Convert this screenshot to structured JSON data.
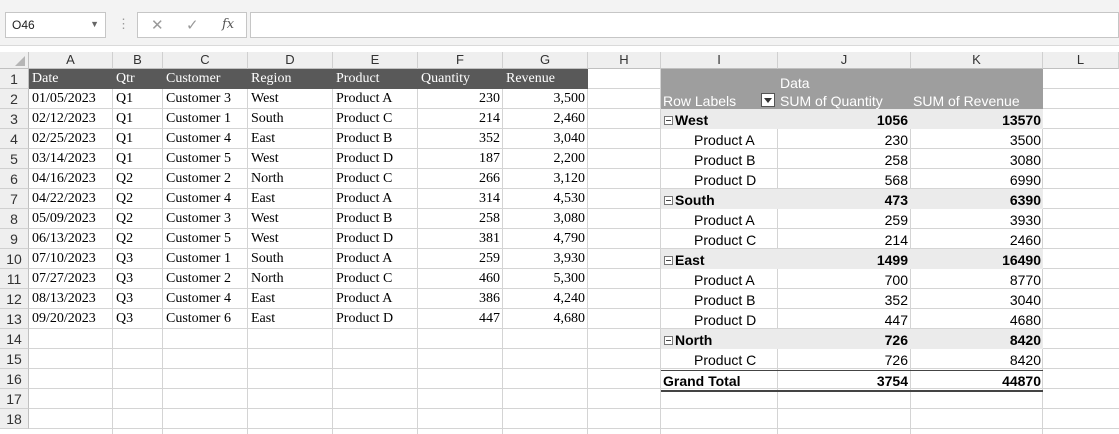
{
  "formula_bar": {
    "name_box": "O46",
    "cancel": "✕",
    "enter": "✓",
    "fx": "fx",
    "formula": ""
  },
  "columns": [
    "A",
    "B",
    "C",
    "D",
    "E",
    "F",
    "G",
    "H",
    "I",
    "J",
    "K",
    "L"
  ],
  "rows": [
    "1",
    "2",
    "3",
    "4",
    "5",
    "6",
    "7",
    "8",
    "9",
    "10",
    "11",
    "12",
    "13",
    "14",
    "15",
    "16",
    "17",
    "18"
  ],
  "table": {
    "headers": [
      "Date",
      "Qtr",
      "Customer",
      "Region",
      "Product",
      "Quantity",
      "Revenue"
    ],
    "rows": [
      [
        "01/05/2023",
        "Q1",
        "Customer 3",
        "West",
        "Product A",
        "230",
        "3,500"
      ],
      [
        "02/12/2023",
        "Q1",
        "Customer 1",
        "South",
        "Product C",
        "214",
        "2,460"
      ],
      [
        "02/25/2023",
        "Q1",
        "Customer 4",
        "East",
        "Product B",
        "352",
        "3,040"
      ],
      [
        "03/14/2023",
        "Q1",
        "Customer 5",
        "West",
        "Product D",
        "187",
        "2,200"
      ],
      [
        "04/16/2023",
        "Q2",
        "Customer 2",
        "North",
        "Product C",
        "266",
        "3,120"
      ],
      [
        "04/22/2023",
        "Q2",
        "Customer 4",
        "East",
        "Product A",
        "314",
        "4,530"
      ],
      [
        "05/09/2023",
        "Q2",
        "Customer 3",
        "West",
        "Product B",
        "258",
        "3,080"
      ],
      [
        "06/13/2023",
        "Q2",
        "Customer 5",
        "West",
        "Product D",
        "381",
        "4,790"
      ],
      [
        "07/10/2023",
        "Q3",
        "Customer 1",
        "South",
        "Product A",
        "259",
        "3,930"
      ],
      [
        "07/27/2023",
        "Q3",
        "Customer 2",
        "North",
        "Product C",
        "460",
        "5,300"
      ],
      [
        "08/13/2023",
        "Q3",
        "Customer 4",
        "East",
        "Product A",
        "386",
        "4,240"
      ],
      [
        "09/20/2023",
        "Q3",
        "Customer 6",
        "East",
        "Product D",
        "447",
        "4,680"
      ]
    ]
  },
  "pivot": {
    "data_label": "Data",
    "row_labels": "Row Labels",
    "sum_qty": "SUM of Quantity",
    "sum_rev": "SUM of Revenue",
    "rows": [
      {
        "label": "West",
        "qty": "1056",
        "rev": "13570",
        "type": "region"
      },
      {
        "label": "Product A",
        "qty": "230",
        "rev": "3500",
        "type": "item"
      },
      {
        "label": "Product B",
        "qty": "258",
        "rev": "3080",
        "type": "item"
      },
      {
        "label": "Product D",
        "qty": "568",
        "rev": "6990",
        "type": "item"
      },
      {
        "label": "South",
        "qty": "473",
        "rev": "6390",
        "type": "region"
      },
      {
        "label": "Product A",
        "qty": "259",
        "rev": "3930",
        "type": "item"
      },
      {
        "label": "Product C",
        "qty": "214",
        "rev": "2460",
        "type": "item"
      },
      {
        "label": "East",
        "qty": "1499",
        "rev": "16490",
        "type": "region"
      },
      {
        "label": "Product A",
        "qty": "700",
        "rev": "8770",
        "type": "item"
      },
      {
        "label": "Product B",
        "qty": "352",
        "rev": "3040",
        "type": "item"
      },
      {
        "label": "Product D",
        "qty": "447",
        "rev": "4680",
        "type": "item"
      },
      {
        "label": "North",
        "qty": "726",
        "rev": "8420",
        "type": "region"
      },
      {
        "label": "Product C",
        "qty": "726",
        "rev": "8420",
        "type": "item"
      }
    ],
    "grand_total": {
      "label": "Grand Total",
      "qty": "3754",
      "rev": "44870"
    }
  },
  "colors": {
    "table_header_bg": "#595959",
    "pivot_header_bg": "#9e9e9e",
    "region_row_bg": "#ebebeb"
  }
}
